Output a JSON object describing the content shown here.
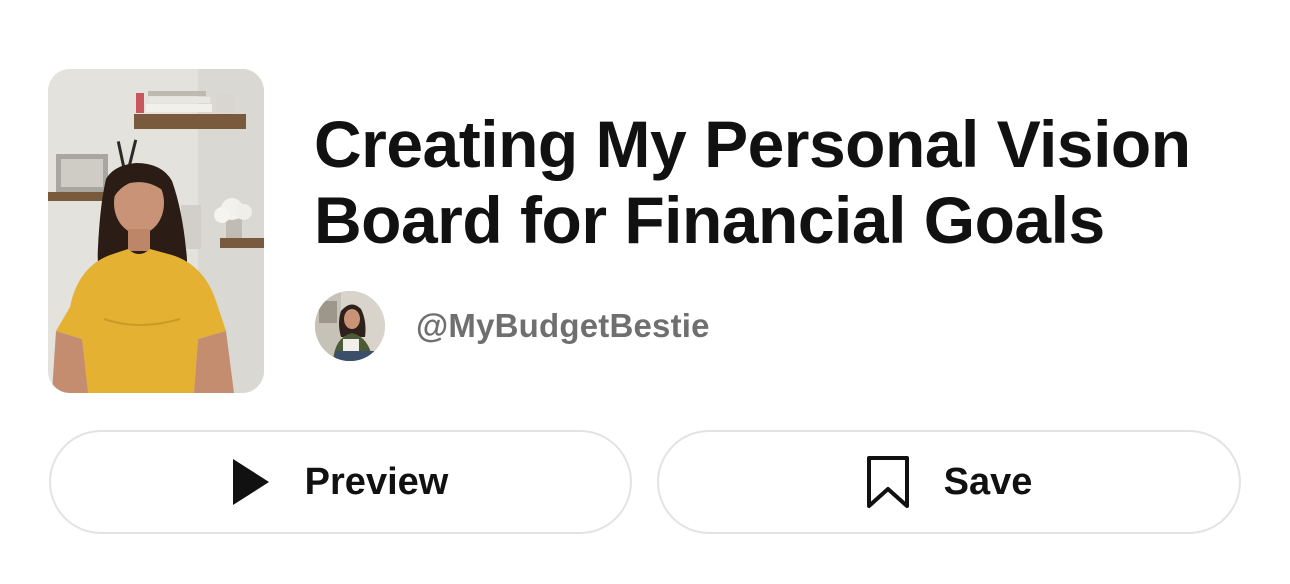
{
  "pin": {
    "title": "Creating My Personal Vision Board for Financial Goals",
    "author_handle": "@MyBudgetBestie",
    "thumbnail_icon": "video-thumbnail-image",
    "avatar_icon": "author-avatar-image"
  },
  "actions": {
    "preview_label": "Preview",
    "preview_icon": "play-icon",
    "save_label": "Save",
    "save_icon": "bookmark-icon"
  },
  "colors": {
    "text_primary": "#111111",
    "text_secondary": "#6f6f6f",
    "button_border": "#e3e3e3",
    "background": "#ffffff"
  }
}
